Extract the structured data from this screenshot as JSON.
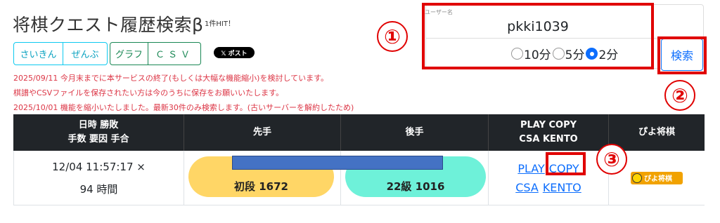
{
  "header": {
    "title": "将棋クエスト履歴検索β",
    "hit_count": "1件HIT！"
  },
  "buttons": {
    "saikin": "さいきん",
    "zenbu": "ぜんぶ",
    "graph": "グラフ",
    "csv": "ＣＳＶ",
    "x_post": "𝕏 ポスト"
  },
  "notices": [
    "2025/09/11 今月末までに本サービスの終了(もしくは大幅な機能縮小)を検討しています。",
    "棋譜やCSVファイルを保存されたい方は今のうちに保存をお願いいたします。",
    "2025/10/01 機能を縮小いたしました。最新30件のみ検索します。(古いサーバーを解約したため)"
  ],
  "search": {
    "user_label": "ユーザー名",
    "user_value": "pkki1039",
    "modes": [
      "10分",
      "5分",
      "2分"
    ],
    "selected_mode": "2分",
    "submit_label": "検索"
  },
  "markers": [
    "①",
    "②",
    "③"
  ],
  "table": {
    "headers": {
      "col1_line1": "日時 勝敗",
      "col1_line2": "手数 要因 手合",
      "col2": "先手",
      "col3": "後手",
      "col4_line1": "PLAY COPY",
      "col4_line2": "CSA KENTO",
      "col5": "ぴよ将棋"
    },
    "rows": [
      {
        "datetime_result": "12/04 11:57:17 ×",
        "moves_reason": "94 時間",
        "sente": "初段 1672",
        "gote": "22級 1016",
        "link_play": "PLAY",
        "link_copy": "COPY",
        "link_csa": "CSA",
        "link_kento": "KENTO",
        "piyo_label": "ぴよ将棋"
      }
    ]
  },
  "colors": {
    "accent_red": "#e00000",
    "notice_red": "#dc3545",
    "sente_bg": "#ffd666",
    "gote_bg": "#6ef1d9",
    "eval_bar": "#4472c4"
  }
}
